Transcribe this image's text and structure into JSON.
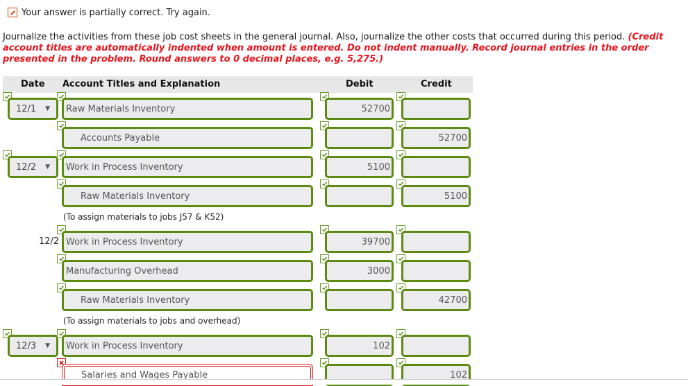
{
  "status": {
    "icon": "pencil-icon",
    "message": "Your answer is partially correct.  Try again."
  },
  "instructions": {
    "plain": "Journalize the activities from these job cost sheets in the general journal. Also, journalize the other costs that occurred during this period. ",
    "emphasis": "(Credit account titles are automatically indented when amount is entered. Do not indent manually. Record journal entries in the order presented in the problem. Round answers to 0 decimal places, e.g. 5,275.)"
  },
  "table": {
    "headers": {
      "date": "Date",
      "account": "Account Titles and Explanation",
      "debit": "Debit",
      "credit": "Credit"
    },
    "rows": [
      {
        "date": "12/1",
        "date_type": "dropdown",
        "account": "Raw Materials Inventory",
        "debit": "52700",
        "credit": "",
        "status": "correct"
      },
      {
        "date": "",
        "account": "Accounts Payable",
        "debit": "",
        "credit": "52700",
        "status": "correct"
      },
      {
        "date": "12/2",
        "date_type": "dropdown",
        "account": "Work in Process Inventory",
        "debit": "5100",
        "credit": "",
        "status": "correct"
      },
      {
        "date": "",
        "account": "Raw Materials Inventory",
        "debit": "",
        "credit": "5100",
        "status": "correct"
      },
      {
        "note": "(To assign materials to jobs J57 & K52)"
      },
      {
        "date": "12/2",
        "date_type": "text",
        "account": "Work in Process Inventory",
        "debit": "39700",
        "credit": "",
        "status": "correct"
      },
      {
        "date": "",
        "account": "Manufacturing Overhead",
        "debit": "3000",
        "credit": "",
        "status": "correct"
      },
      {
        "date": "",
        "account": "Raw Materials Inventory",
        "debit": "",
        "credit": "42700",
        "status": "correct"
      },
      {
        "note": "(To assign materials to jobs and overhead)"
      },
      {
        "date": "12/3",
        "date_type": "dropdown",
        "account": "Work in Process Inventory",
        "debit": "102",
        "credit": "",
        "status": "correct"
      },
      {
        "date": "",
        "account": "Salaries and Wages Payable",
        "debit": "",
        "credit": "102",
        "status": "incorrect"
      }
    ]
  },
  "colors": {
    "correct_border": "#5c8a12",
    "incorrect_border": "#d81b1b",
    "emphasis_text": "#e8141c",
    "status_icon": "#d44a13"
  }
}
